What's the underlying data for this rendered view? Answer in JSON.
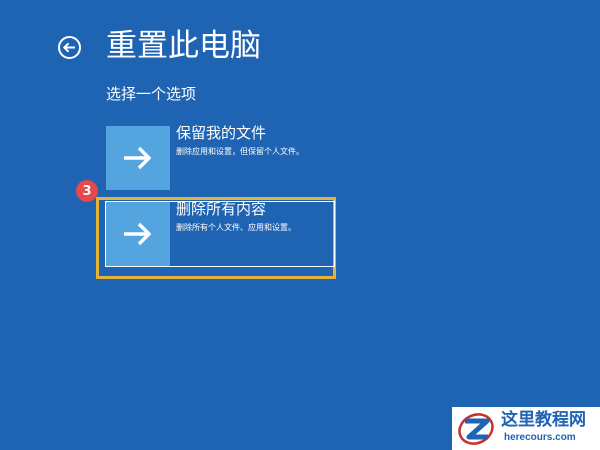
{
  "header": {
    "title": "重置此电脑",
    "back_icon": "circle-back-arrow-icon"
  },
  "subtitle": "选择一个选项",
  "options": [
    {
      "title": "保留我的文件",
      "description": "删除应用和设置，但保留个人文件。",
      "icon": "arrow-right-icon"
    },
    {
      "title": "删除所有内容",
      "description": "删除所有个人文件、应用和设置。",
      "icon": "arrow-right-icon"
    }
  ],
  "step_badge": "3",
  "watermark": {
    "name": "这里教程网",
    "url": "herecours.com"
  },
  "colors": {
    "background": "#1f63b3",
    "tile": "#54a4e0",
    "highlight": "#e4b43a",
    "badge": "#e5484d",
    "watermark_text": "#1e63b6"
  }
}
